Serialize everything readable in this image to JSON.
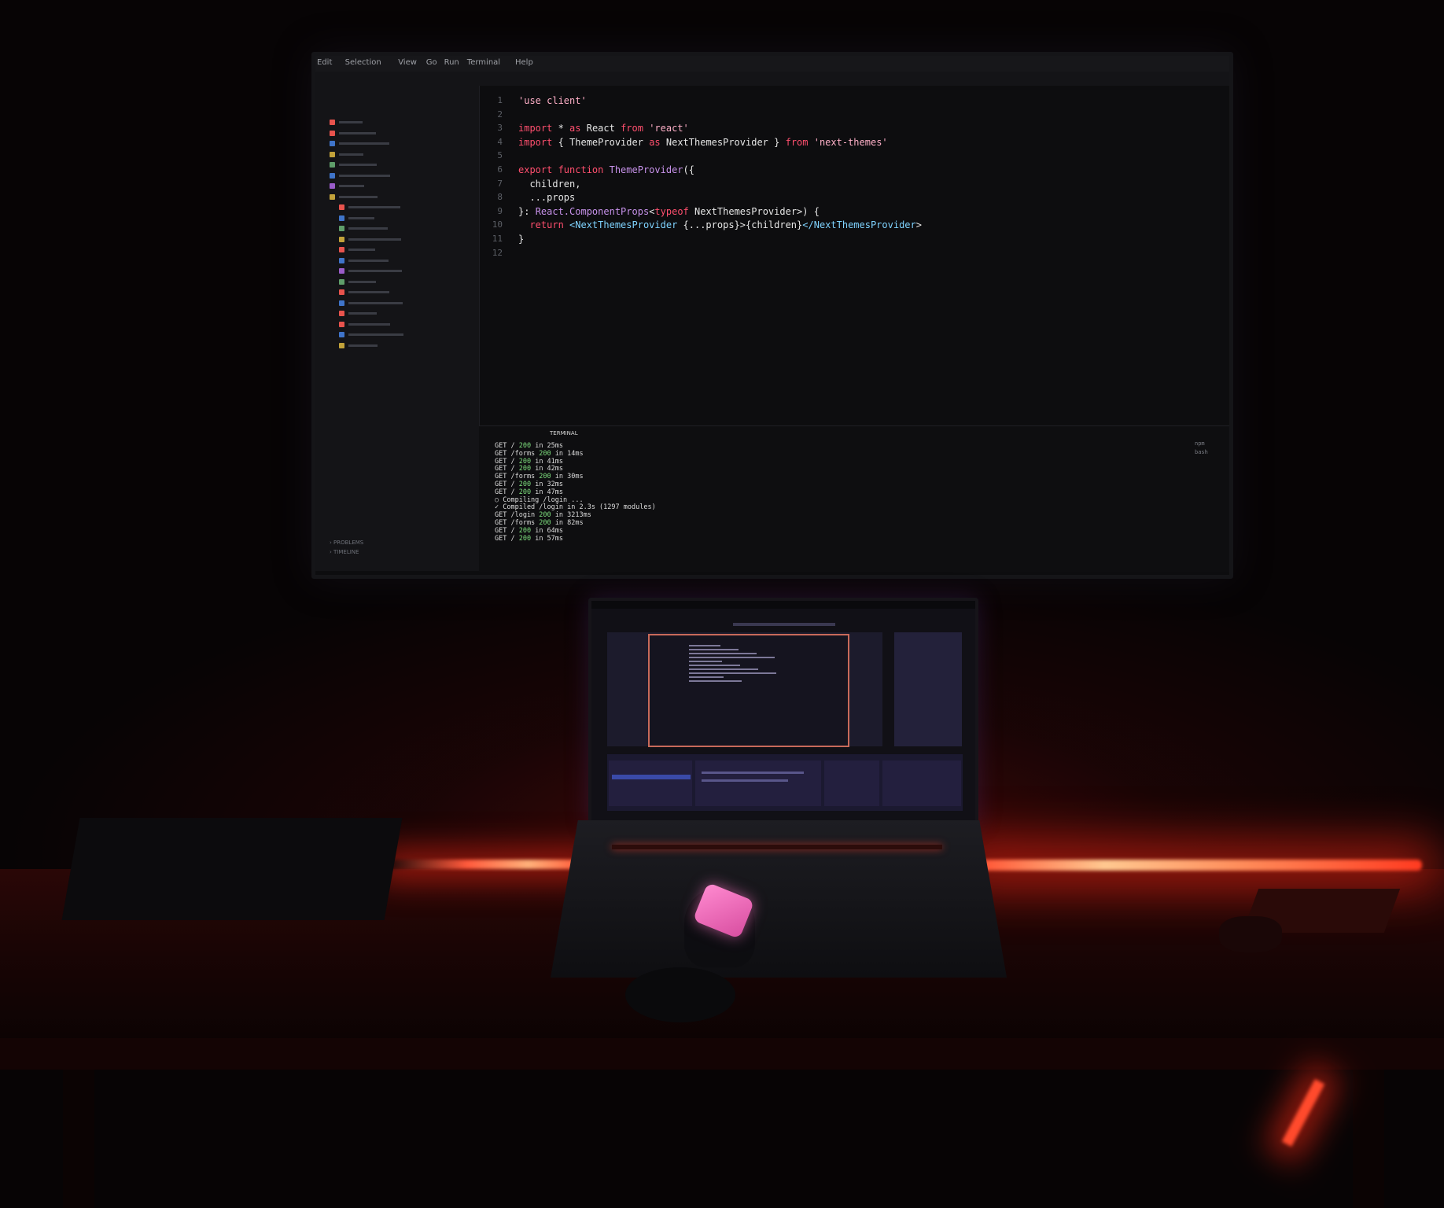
{
  "monitor": {
    "menu": [
      "Edit",
      "Selection",
      "View",
      "Go",
      "Run",
      "Terminal",
      "Help"
    ],
    "code_lines": [
      {
        "n": "1",
        "tokens": [
          [
            "str",
            "'use client'"
          ]
        ]
      },
      {
        "n": "2",
        "tokens": []
      },
      {
        "n": "3",
        "tokens": [
          [
            "kw",
            "import"
          ],
          [
            "id",
            " * "
          ],
          [
            "kw",
            "as"
          ],
          [
            "id",
            " React "
          ],
          [
            "kw",
            "from"
          ],
          [
            "str",
            " 'react'"
          ]
        ]
      },
      {
        "n": "4",
        "tokens": [
          [
            "kw",
            "import"
          ],
          [
            "id",
            " { ThemeProvider "
          ],
          [
            "kw",
            "as"
          ],
          [
            "id",
            " NextThemesProvider } "
          ],
          [
            "kw",
            "from"
          ],
          [
            "str",
            " 'next-themes'"
          ]
        ]
      },
      {
        "n": "5",
        "tokens": []
      },
      {
        "n": "6",
        "tokens": [
          [
            "kw",
            "export function "
          ],
          [
            "fn",
            "ThemeProvider"
          ],
          [
            "id",
            "({"
          ]
        ]
      },
      {
        "n": "7",
        "tokens": [
          [
            "id",
            "  children,"
          ]
        ]
      },
      {
        "n": "8",
        "tokens": [
          [
            "id",
            "  ...props"
          ]
        ]
      },
      {
        "n": "9",
        "tokens": [
          [
            "id",
            "}: "
          ],
          [
            "fn",
            "React.ComponentProps"
          ],
          [
            "id",
            "<"
          ],
          [
            "kw",
            "typeof "
          ],
          [
            "id",
            "NextThemesProvider>) {"
          ]
        ]
      },
      {
        "n": "10",
        "tokens": [
          [
            "kw",
            "  return "
          ],
          [
            "ty",
            "<NextThemesProvider"
          ],
          [
            "id",
            " {...props}>{children}"
          ],
          [
            "ty",
            "</NextThemesProvider"
          ],
          [
            "id",
            ">"
          ]
        ]
      },
      {
        "n": "11",
        "tokens": [
          [
            "id",
            "}"
          ]
        ]
      },
      {
        "n": "12",
        "tokens": []
      }
    ],
    "panel_tab_active": "TERMINAL",
    "terminal": [
      [
        "GET / ",
        "200",
        " in 25ms"
      ],
      [
        "GET /forms ",
        "200",
        " in 14ms"
      ],
      [
        "GET / ",
        "200",
        " in 41ms"
      ],
      [
        "GET / ",
        "200",
        " in 42ms"
      ],
      [
        "GET /forms ",
        "200",
        " in 30ms"
      ],
      [
        "GET / ",
        "200",
        " in 32ms"
      ],
      [
        "GET / ",
        "200",
        " in 47ms"
      ],
      [
        "○ Compiling /login ...",
        "",
        ""
      ],
      [
        "✓ Compiled /login in 2.3s (1297 modules)",
        "",
        ""
      ],
      [
        "GET /login ",
        "200",
        " in 3213ms"
      ],
      [
        "GET /forms ",
        "200",
        " in 82ms"
      ],
      [
        "GET / ",
        "200",
        " in 64ms"
      ],
      [
        "GET / ",
        "200",
        " in 57ms"
      ]
    ],
    "terminal_side": [
      "npm",
      "bash"
    ],
    "sidebar_bottom": [
      "PROBLEMS",
      "TIMELINE"
    ]
  }
}
